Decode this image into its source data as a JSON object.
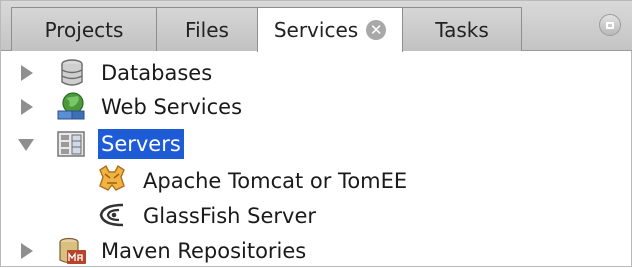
{
  "tabs": [
    {
      "label": "Projects"
    },
    {
      "label": "Files"
    },
    {
      "label": "Services",
      "active": true,
      "close_icon": "close-icon"
    },
    {
      "label": "Tasks"
    }
  ],
  "tree": {
    "items": [
      {
        "label": "Databases",
        "icon": "database-icon",
        "state": "collapsed"
      },
      {
        "label": "Web Services",
        "icon": "web-services-icon",
        "state": "collapsed"
      },
      {
        "label": "Servers",
        "icon": "servers-icon",
        "state": "expanded",
        "selected": true,
        "children": [
          {
            "label": "Apache Tomcat or TomEE",
            "icon": "tomcat-icon"
          },
          {
            "label": "GlassFish Server",
            "icon": "glassfish-icon"
          }
        ]
      },
      {
        "label": "Maven Repositories",
        "icon": "maven-icon",
        "state": "collapsed"
      }
    ]
  },
  "colors": {
    "selection": "#1e5bd6",
    "toggle": "#8f8f8f"
  }
}
